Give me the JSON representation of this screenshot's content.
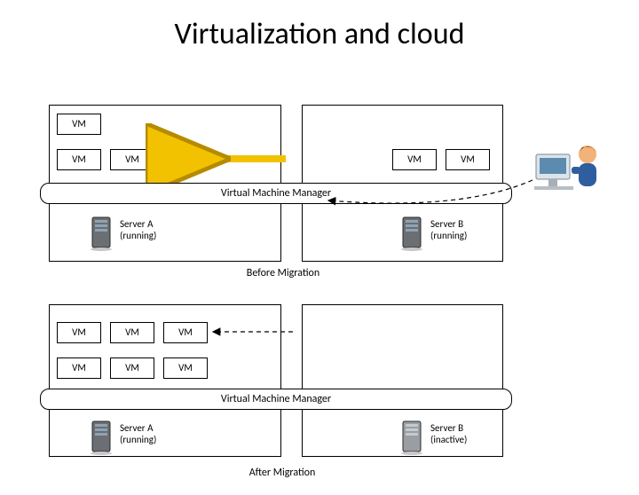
{
  "title": "Virtualization and cloud",
  "vm_label": "VM",
  "vmm_label": "Virtual Machine Manager",
  "server_a": {
    "name": "Server A",
    "state_running": "(running)"
  },
  "server_b": {
    "name": "Server B",
    "state_running": "(running)",
    "state_inactive": "(inactive)"
  },
  "stages": {
    "before": "Before Migration",
    "after": "After Migration"
  }
}
